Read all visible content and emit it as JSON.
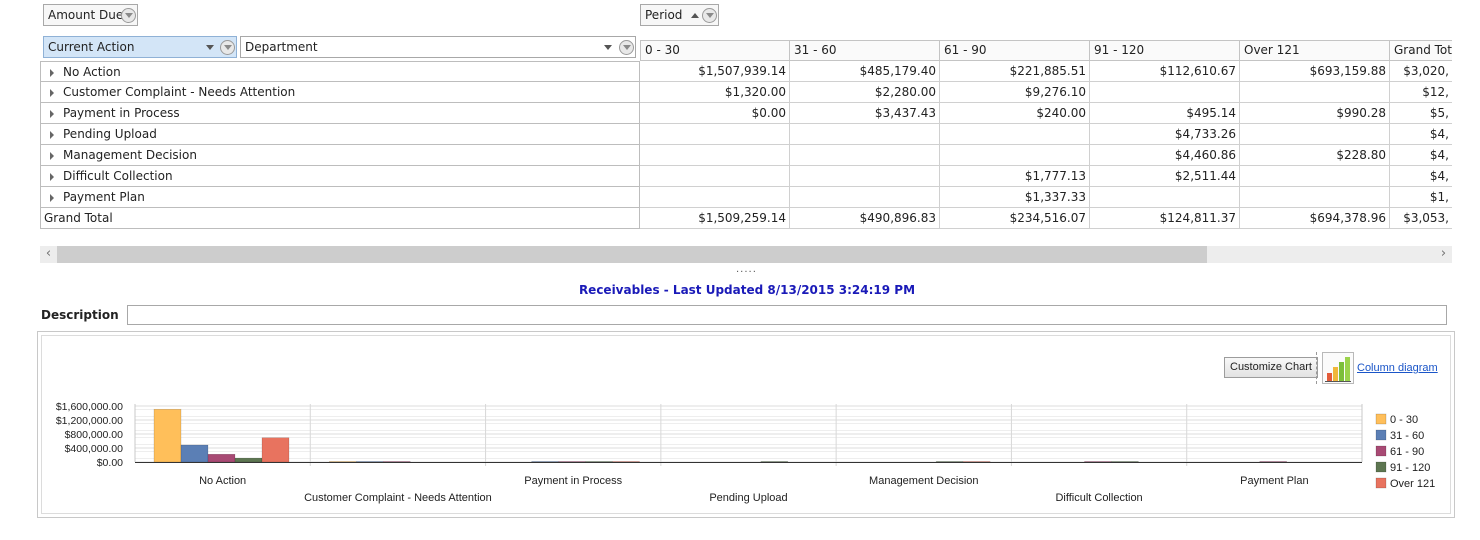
{
  "fields": {
    "data_field": "Amount Due",
    "column_field": "Period",
    "row_field_1": "Current Action",
    "row_field_2": "Department"
  },
  "columns": [
    "0 - 30",
    "31 - 60",
    "61 - 90",
    "91 - 120",
    "Over 121",
    "Grand Tota"
  ],
  "rows": [
    {
      "label": "No Action",
      "values": [
        "$1,507,939.14",
        "$485,179.40",
        "$221,885.51",
        "$112,610.67",
        "$693,159.88",
        "$3,020,"
      ]
    },
    {
      "label": "Customer Complaint - Needs Attention",
      "values": [
        "$1,320.00",
        "$2,280.00",
        "$9,276.10",
        "",
        "",
        "$12,"
      ]
    },
    {
      "label": "Payment in Process",
      "values": [
        "$0.00",
        "$3,437.43",
        "$240.00",
        "$495.14",
        "$990.28",
        "$5,"
      ]
    },
    {
      "label": "Pending Upload",
      "values": [
        "",
        "",
        "",
        "$4,733.26",
        "",
        "$4,"
      ]
    },
    {
      "label": "Management Decision",
      "values": [
        "",
        "",
        "",
        "$4,460.86",
        "$228.80",
        "$4,"
      ]
    },
    {
      "label": "Difficult Collection",
      "values": [
        "",
        "",
        "$1,777.13",
        "$2,511.44",
        "",
        "$4,"
      ]
    },
    {
      "label": "Payment Plan",
      "values": [
        "",
        "",
        "$1,337.33",
        "",
        "",
        "$1,"
      ]
    }
  ],
  "grand_total": {
    "label": "Grand Total",
    "values": [
      "$1,509,259.14",
      "$490,896.83",
      "$234,516.07",
      "$124,811.37",
      "$694,378.96",
      "$3,053,"
    ]
  },
  "scrollbar": {
    "left_arrow": "‹",
    "right_arrow": "›",
    "grip": "....."
  },
  "report_title": "Receivables - Last Updated 8/13/2015 3:24:19 PM",
  "description": {
    "label": "Description",
    "value": ""
  },
  "chart_toolbar": {
    "customize_label": "Customize Chart",
    "diagram_label": "Column diagram"
  },
  "colors": {
    "series": [
      "#ffbf5a",
      "#5b7fb5",
      "#a84a74",
      "#5d7651",
      "#e8735f"
    ],
    "link": "#1a1ab8",
    "row_field_bg": "#d3e5f7"
  },
  "chart_data": {
    "type": "bar",
    "categories": [
      "No Action",
      "Customer Complaint - Needs Attention",
      "Payment in Process",
      "Pending Upload",
      "Management Decision",
      "Difficult Collection",
      "Payment Plan"
    ],
    "series": [
      {
        "name": "0 - 30",
        "values": [
          1507939.14,
          1320.0,
          0.0,
          0,
          0,
          0,
          0
        ]
      },
      {
        "name": "31 - 60",
        "values": [
          485179.4,
          2280.0,
          3437.43,
          0,
          0,
          0,
          0
        ]
      },
      {
        "name": "61 - 90",
        "values": [
          221885.51,
          9276.1,
          240.0,
          0,
          0,
          1777.13,
          1337.33
        ]
      },
      {
        "name": "91 - 120",
        "values": [
          112610.67,
          0,
          495.14,
          4733.26,
          4460.86,
          2511.44,
          0
        ]
      },
      {
        "name": "Over 121",
        "values": [
          693159.88,
          0,
          990.28,
          0,
          228.8,
          0,
          0
        ]
      }
    ],
    "yticks": [
      "$0.00",
      "$400,000.00",
      "$800,000.00",
      "$1,200,000.00",
      "$1,600,000.00"
    ],
    "ylim": [
      0,
      1600000
    ],
    "legend_position": "right",
    "grid": true
  }
}
